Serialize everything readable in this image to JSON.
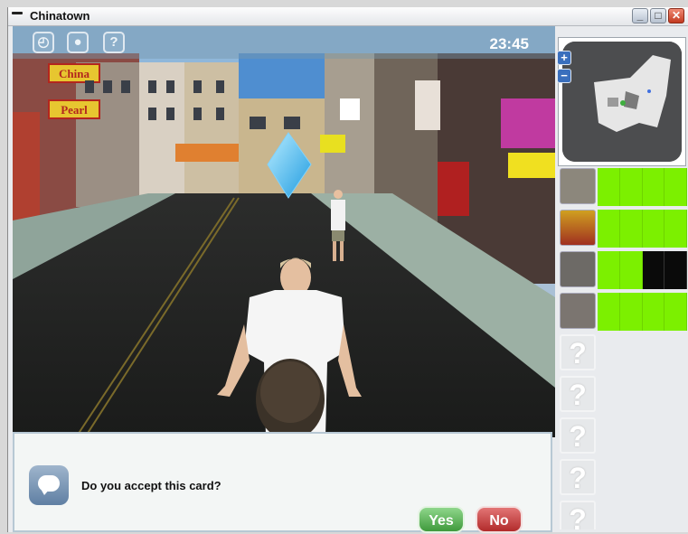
{
  "window": {
    "title": "Chinatown",
    "minimize": "_",
    "maximize": "□",
    "close": "✕"
  },
  "hud": {
    "icons": [
      "clock-icon",
      "person-icon",
      "help-icon"
    ],
    "help_glyph": "?",
    "time": "23:45"
  },
  "scene": {
    "signs": {
      "sign1": "China",
      "sign2": "Pearl"
    }
  },
  "minimap": {
    "zoom_in": "+",
    "zoom_out": "−"
  },
  "cards": [
    {
      "status": "known",
      "progress": [
        1,
        1,
        1,
        1
      ]
    },
    {
      "status": "known",
      "progress": [
        1,
        1,
        1,
        1
      ]
    },
    {
      "status": "known",
      "progress": [
        1,
        1,
        0,
        0
      ]
    },
    {
      "status": "known",
      "progress": [
        1,
        1,
        1,
        1
      ]
    },
    {
      "status": "unknown",
      "glyph": "?"
    },
    {
      "status": "unknown",
      "glyph": "?"
    },
    {
      "status": "unknown",
      "glyph": "?"
    },
    {
      "status": "unknown",
      "glyph": "?"
    },
    {
      "status": "unknown",
      "glyph": "?"
    }
  ],
  "dialog": {
    "question": "Do you accept this card?",
    "yes_label": "Yes",
    "no_label": "No"
  },
  "colors": {
    "progress_on": "#7cf000",
    "progress_off": "#0a0a0a",
    "yes_button": "#4fae4b",
    "no_button": "#c63b3b",
    "crystal": "#3fb8f0"
  }
}
